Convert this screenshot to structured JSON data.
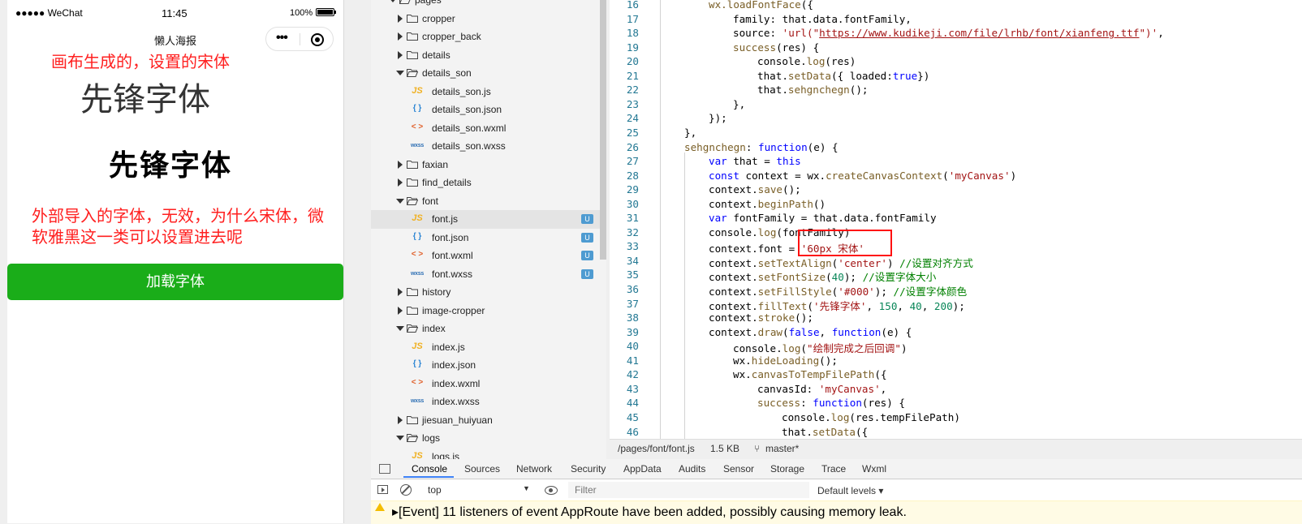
{
  "simulator": {
    "status": {
      "carrier": "●●●●● WeChat",
      "time": "11:45",
      "battery": "100%"
    },
    "nav_title": "懒人海报",
    "capsule": {
      "more": "•••"
    },
    "note_canvas": "画布生成的，设置的宋体",
    "canvas_text": "先锋字体",
    "bold_text": "先锋字体",
    "note_external": "外部导入的字体，无效，为什么宋体，微软雅黑这一类可以设置进去呢",
    "button_label": "加载字体",
    "button_color": "#1aad19"
  },
  "file_tree": {
    "items": [
      {
        "label": "pages",
        "type": "folder",
        "open": true,
        "depth": 0
      },
      {
        "label": "cropper",
        "type": "folder",
        "open": false,
        "depth": 1
      },
      {
        "label": "cropper_back",
        "type": "folder",
        "open": false,
        "depth": 1
      },
      {
        "label": "details",
        "type": "folder",
        "open": false,
        "depth": 1
      },
      {
        "label": "details_son",
        "type": "folder",
        "open": true,
        "depth": 1
      },
      {
        "label": "details_son.js",
        "type": "js",
        "depth": 2
      },
      {
        "label": "details_son.json",
        "type": "json",
        "depth": 2
      },
      {
        "label": "details_son.wxml",
        "type": "wxml",
        "depth": 2
      },
      {
        "label": "details_son.wxss",
        "type": "wxss",
        "depth": 2
      },
      {
        "label": "faxian",
        "type": "folder",
        "open": false,
        "depth": 1
      },
      {
        "label": "find_details",
        "type": "folder",
        "open": false,
        "depth": 1
      },
      {
        "label": "font",
        "type": "folder",
        "open": true,
        "depth": 1
      },
      {
        "label": "font.js",
        "type": "js",
        "depth": 2,
        "badge": "U",
        "selected": true
      },
      {
        "label": "font.json",
        "type": "json",
        "depth": 2,
        "badge": "U"
      },
      {
        "label": "font.wxml",
        "type": "wxml",
        "depth": 2,
        "badge": "U"
      },
      {
        "label": "font.wxss",
        "type": "wxss",
        "depth": 2,
        "badge": "U"
      },
      {
        "label": "history",
        "type": "folder",
        "open": false,
        "depth": 1
      },
      {
        "label": "image-cropper",
        "type": "folder",
        "open": false,
        "depth": 1
      },
      {
        "label": "index",
        "type": "folder",
        "open": true,
        "depth": 1
      },
      {
        "label": "index.js",
        "type": "js",
        "depth": 2
      },
      {
        "label": "index.json",
        "type": "json",
        "depth": 2
      },
      {
        "label": "index.wxml",
        "type": "wxml",
        "depth": 2
      },
      {
        "label": "index.wxss",
        "type": "wxss",
        "depth": 2
      },
      {
        "label": "jiesuan_huiyuan",
        "type": "folder",
        "open": false,
        "depth": 1
      },
      {
        "label": "logs",
        "type": "folder",
        "open": true,
        "depth": 1
      },
      {
        "label": "logs.js",
        "type": "js",
        "depth": 2
      }
    ],
    "icon_labels": {
      "js": "JS",
      "json": "{ }",
      "wxml": "< >",
      "wxss": "wxss"
    }
  },
  "editor": {
    "lines": [
      {
        "n": 16,
        "indent": 1,
        "tokens": [
          [
            "wx.",
            "fn"
          ],
          [
            "loadFontFace",
            "fn"
          ],
          [
            "({",
            ""
          ]
        ]
      },
      {
        "n": 17,
        "indent": 2,
        "tokens": [
          [
            "family: that.data.fontFamily,",
            ""
          ]
        ]
      },
      {
        "n": 18,
        "indent": 2,
        "tokens": [
          [
            "source: ",
            ""
          ],
          [
            "'url(\"",
            "str"
          ],
          [
            "https://www.kudikeji.com/file/lrhb/font/xianfeng.ttf",
            "str link"
          ],
          [
            "\")'",
            "str"
          ],
          [
            ",",
            ""
          ]
        ]
      },
      {
        "n": 19,
        "indent": 2,
        "tokens": [
          [
            "success",
            "fn"
          ],
          [
            "(res) {",
            ""
          ]
        ]
      },
      {
        "n": 20,
        "indent": 3,
        "tokens": [
          [
            "console.",
            ""
          ],
          [
            "log",
            "fn"
          ],
          [
            "(res)",
            ""
          ]
        ]
      },
      {
        "n": 21,
        "indent": 3,
        "tokens": [
          [
            "that.",
            ""
          ],
          [
            "setData",
            "fn"
          ],
          [
            "({ loaded:",
            ""
          ],
          [
            "true",
            "kw"
          ],
          [
            "})",
            ""
          ]
        ]
      },
      {
        "n": 22,
        "indent": 3,
        "tokens": [
          [
            "that.",
            ""
          ],
          [
            "sehgnchegn",
            "fn"
          ],
          [
            "();",
            ""
          ]
        ]
      },
      {
        "n": 23,
        "indent": 2,
        "tokens": [
          [
            "},",
            ""
          ]
        ]
      },
      {
        "n": 24,
        "indent": 1,
        "tokens": [
          [
            "});",
            ""
          ]
        ]
      },
      {
        "n": 25,
        "indent": 0,
        "tokens": [
          [
            "},",
            ""
          ]
        ]
      },
      {
        "n": 26,
        "indent": 0,
        "tokens": [
          [
            "sehgnchegn",
            "fn"
          ],
          [
            ": ",
            ""
          ],
          [
            "function",
            "kw"
          ],
          [
            "(e) {",
            ""
          ]
        ]
      },
      {
        "n": 27,
        "indent": 1,
        "tokens": [
          [
            "var",
            "kw"
          ],
          [
            " that = ",
            ""
          ],
          [
            "this",
            "kw"
          ]
        ]
      },
      {
        "n": 28,
        "indent": 1,
        "tokens": [
          [
            "const",
            "kw"
          ],
          [
            " context = wx.",
            ""
          ],
          [
            "createCanvasContext",
            "fn"
          ],
          [
            "(",
            ""
          ],
          [
            "'myCanvas'",
            "str"
          ],
          [
            ")",
            ""
          ]
        ]
      },
      {
        "n": 29,
        "indent": 1,
        "tokens": [
          [
            "context.",
            ""
          ],
          [
            "save",
            "fn"
          ],
          [
            "();",
            ""
          ]
        ]
      },
      {
        "n": 30,
        "indent": 1,
        "tokens": [
          [
            "context.",
            ""
          ],
          [
            "beginPath",
            "fn"
          ],
          [
            "()",
            ""
          ]
        ]
      },
      {
        "n": 31,
        "indent": 1,
        "tokens": [
          [
            "var",
            "kw"
          ],
          [
            " fontFamily = that.data.fontFamily",
            ""
          ]
        ]
      },
      {
        "n": 32,
        "indent": 1,
        "tokens": [
          [
            "console.",
            ""
          ],
          [
            "log",
            "fn"
          ],
          [
            "(fontFamily)",
            ""
          ]
        ]
      },
      {
        "n": 33,
        "indent": 1,
        "tokens": [
          [
            "context.font = ",
            ""
          ],
          [
            "'60px 宋体'",
            "str"
          ]
        ]
      },
      {
        "n": 34,
        "indent": 1,
        "tokens": [
          [
            "context.",
            ""
          ],
          [
            "setTextAlign",
            "fn"
          ],
          [
            "(",
            ""
          ],
          [
            "'center'",
            "str"
          ],
          [
            ") ",
            ""
          ],
          [
            "//设置对齐方式",
            "cm"
          ]
        ]
      },
      {
        "n": 35,
        "indent": 1,
        "tokens": [
          [
            "context.",
            ""
          ],
          [
            "setFontSize",
            "fn"
          ],
          [
            "(",
            ""
          ],
          [
            "40",
            "num"
          ],
          [
            "); ",
            ""
          ],
          [
            "//设置字体大小",
            "cm"
          ]
        ]
      },
      {
        "n": 36,
        "indent": 1,
        "tokens": [
          [
            "context.",
            ""
          ],
          [
            "setFillStyle",
            "fn"
          ],
          [
            "(",
            ""
          ],
          [
            "'#000'",
            "str"
          ],
          [
            "); ",
            ""
          ],
          [
            "//设置字体颜色",
            "cm"
          ]
        ]
      },
      {
        "n": 37,
        "indent": 1,
        "tokens": [
          [
            "context.",
            ""
          ],
          [
            "fillText",
            "fn"
          ],
          [
            "(",
            ""
          ],
          [
            "'先锋字体'",
            "str"
          ],
          [
            ", ",
            ""
          ],
          [
            "150",
            "num"
          ],
          [
            ", ",
            ""
          ],
          [
            "40",
            "num"
          ],
          [
            ", ",
            ""
          ],
          [
            "200",
            "num"
          ],
          [
            ");",
            ""
          ]
        ]
      },
      {
        "n": 38,
        "indent": 1,
        "tokens": [
          [
            "context.",
            ""
          ],
          [
            "stroke",
            "fn"
          ],
          [
            "();",
            ""
          ]
        ]
      },
      {
        "n": 39,
        "indent": 1,
        "tokens": [
          [
            "context.",
            ""
          ],
          [
            "draw",
            "fn"
          ],
          [
            "(",
            ""
          ],
          [
            "false",
            "kw"
          ],
          [
            ", ",
            ""
          ],
          [
            "function",
            "kw"
          ],
          [
            "(e) {",
            ""
          ]
        ]
      },
      {
        "n": 40,
        "indent": 2,
        "tokens": [
          [
            "console.",
            ""
          ],
          [
            "log",
            "fn"
          ],
          [
            "(",
            ""
          ],
          [
            "\"绘制完成之后回调\"",
            "str"
          ],
          [
            ")",
            ""
          ]
        ]
      },
      {
        "n": 41,
        "indent": 2,
        "tokens": [
          [
            "wx.",
            ""
          ],
          [
            "hideLoading",
            "fn"
          ],
          [
            "();",
            ""
          ]
        ]
      },
      {
        "n": 42,
        "indent": 2,
        "tokens": [
          [
            "wx.",
            ""
          ],
          [
            "canvasToTempFilePath",
            "fn"
          ],
          [
            "({",
            ""
          ]
        ]
      },
      {
        "n": 43,
        "indent": 3,
        "tokens": [
          [
            "canvasId: ",
            ""
          ],
          [
            "'myCanvas'",
            "str"
          ],
          [
            ",",
            ""
          ]
        ]
      },
      {
        "n": 44,
        "indent": 3,
        "tokens": [
          [
            "success",
            "fn"
          ],
          [
            ": ",
            ""
          ],
          [
            "function",
            "kw"
          ],
          [
            "(res) {",
            ""
          ]
        ]
      },
      {
        "n": 45,
        "indent": 4,
        "tokens": [
          [
            "console.",
            ""
          ],
          [
            "log",
            "fn"
          ],
          [
            "(res.tempFilePath)",
            ""
          ]
        ]
      },
      {
        "n": 46,
        "indent": 4,
        "tokens": [
          [
            "that.",
            ""
          ],
          [
            "setData",
            "fn"
          ],
          [
            "({",
            ""
          ]
        ]
      }
    ]
  },
  "editor_status": {
    "path": "/pages/font/font.js",
    "size": "1.5 KB",
    "branch": "master*"
  },
  "devtools": {
    "tabs": [
      "Console",
      "Sources",
      "Network",
      "Security",
      "AppData",
      "Audits",
      "Sensor",
      "Storage",
      "Trace",
      "Wxml"
    ],
    "active_tab": "Console",
    "context": "top",
    "filter_placeholder": "Filter",
    "levels": "Default levels ▾",
    "warning": "▸[Event] 11 listeners of event AppRoute have been added, possibly causing memory leak."
  }
}
